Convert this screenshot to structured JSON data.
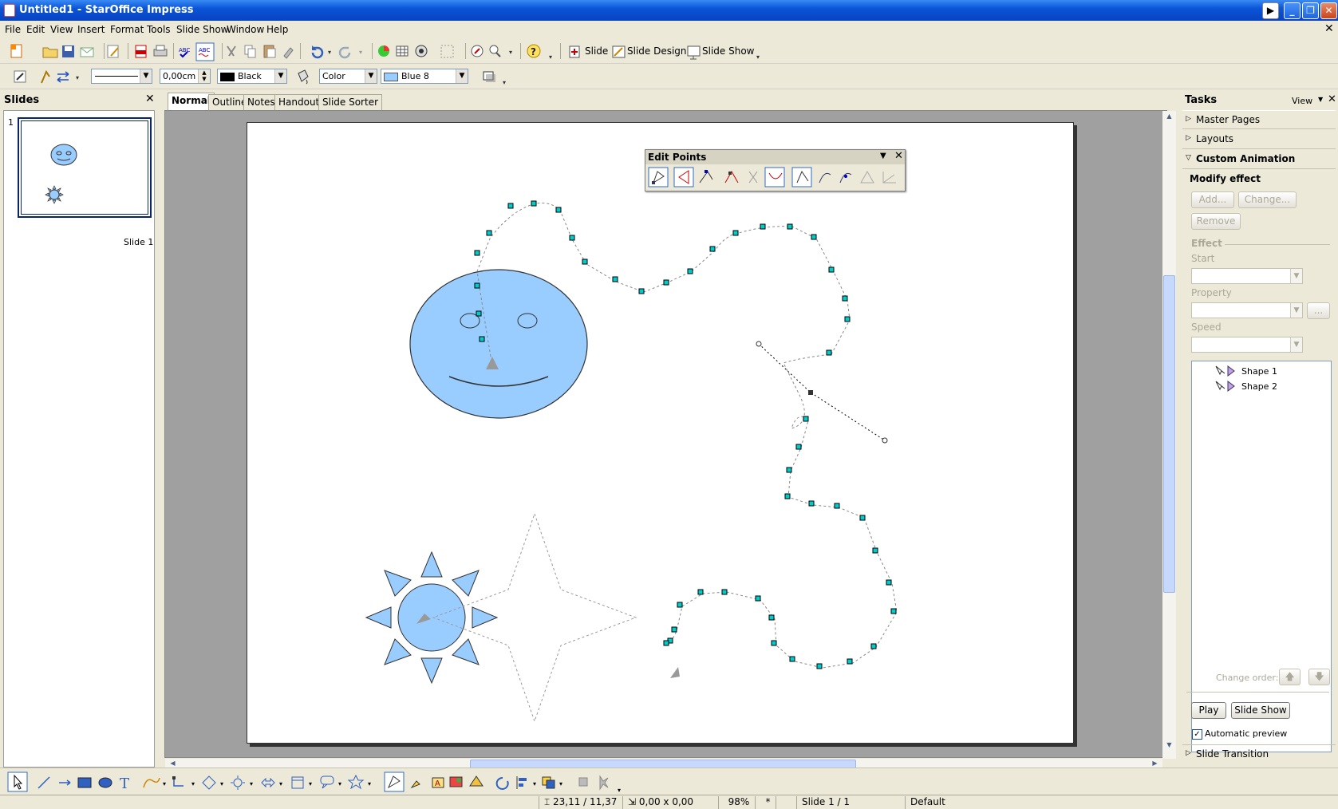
{
  "window": {
    "title": "Untitled1 - StarOffice Impress"
  },
  "menu": [
    "File",
    "Edit",
    "View",
    "Insert",
    "Format",
    "Tools",
    "Slide Show",
    "Window",
    "Help"
  ],
  "toolbar1": {
    "slide": "Slide",
    "slide_design": "Slide Design",
    "slide_show": "Slide Show"
  },
  "toolbar2": {
    "line_width": "0,00cm",
    "line_color": "Black",
    "area_style": "Color",
    "area_color": "Blue 8"
  },
  "slides_panel": {
    "title": "Slides",
    "slide_number": "1",
    "slide_label": "Slide 1"
  },
  "view_tabs": [
    "Normal",
    "Outline",
    "Notes",
    "Handout",
    "Slide Sorter"
  ],
  "edit_points": {
    "title": "Edit Points"
  },
  "tasks": {
    "title": "Tasks",
    "view_label": "View",
    "sections": [
      "Master Pages",
      "Layouts",
      "Custom Animation"
    ],
    "modify_effect": "Modify effect",
    "add": "Add...",
    "change": "Change...",
    "remove": "Remove",
    "effect": "Effect",
    "start": "Start",
    "property": "Property",
    "speed": "Speed",
    "more": "...",
    "shapes": [
      "Shape 1",
      "Shape 2"
    ],
    "change_order": "Change order:",
    "play": "Play",
    "slide_show": "Slide Show",
    "automatic_preview": "Automatic preview",
    "automatic_preview_checked": true,
    "slide_transition": "Slide Transition"
  },
  "status": {
    "position": "23,11 / 11,37",
    "size": "0,00 x 0,00",
    "zoom": "98%",
    "modified": "*",
    "slide": "Slide 1 / 1",
    "layout": "Default"
  },
  "colors": {
    "titlebar": "#0a55d8",
    "shape_fill": "#99ccff",
    "handle": "#00cccc",
    "selection": "#0a246a"
  }
}
